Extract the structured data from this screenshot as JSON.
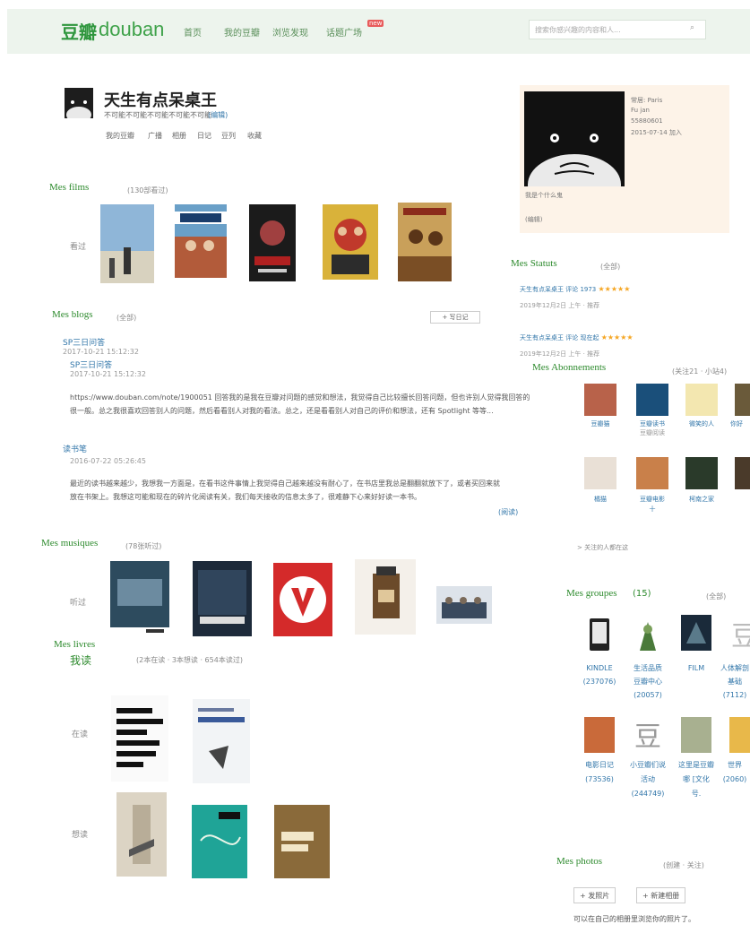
{
  "nav": {
    "logo_cn": "豆瓣",
    "logo_en": "douban",
    "links": [
      "首页",
      "我的豆瓣",
      "浏览发现",
      "话题广场"
    ],
    "new_badge": "new",
    "search_placeholder": "搜索你感兴趣的内容和人..."
  },
  "user": {
    "name": "天生有点呆桌王",
    "signature": "不可能不可能不可能不可能不可能",
    "signature_edit": "(编辑)",
    "tabs": [
      "我的豆瓣",
      "广播",
      "相册",
      "日记",
      "豆列",
      "收藏"
    ]
  },
  "films": {
    "title": "Mes films",
    "meta": "(130部看过)",
    "row_label": "看过"
  },
  "blogs": {
    "title": "Mes blogs",
    "meta": "(全部)",
    "write_button": "+ 写日记",
    "entries": [
      {
        "title": "SP三日问答",
        "date": "2017-10-21 15:12:32",
        "sub_title": "SP三日问答",
        "sub_date": "2017-10-21 15:12:32",
        "text": "https://www.douban.com/note/1900051 回答我的是我在豆瓣对问题的感觉和想法，我觉得自己比较擅长回答问题，但也许别人觉得我回答的很一般。总之我很喜欢回答别人的问题，然后看看别人对我的看法。总之，还是看看别人对自己的评价和想法，还有 Spotlight 等等..."
      },
      {
        "title": "读书笔",
        "date": "2016-07-22 05:26:45",
        "text": "最近的读书越来越少，我想我一方面是，在看书这件事情上我觉得自己越来越没有耐心了，在书店里我总是翻翻就放下了，或者买回来就放在书架上。我想这可能和现在的碎片化阅读有关，我们每天接收的信息太多了，很难静下心来好好读一本书。",
        "more": "(阅读)"
      }
    ]
  },
  "musiques": {
    "title": "Mes musiques",
    "meta": "(78张听过)",
    "row_label": "听过"
  },
  "livres": {
    "title": "Mes livres",
    "summary_label": "我读",
    "summary_meta": "(2本在读 · 3本想读 · 654本读过)",
    "row1_label": "在读",
    "row2_label": "想读"
  },
  "profile": {
    "lines": [
      "常居: Paris",
      "Fu jan",
      "55880601",
      "2015-07-14 加入"
    ],
    "intro": "我是个什么鬼",
    "edit": "(编辑)"
  },
  "statuts": {
    "title": "Mes Statuts",
    "meta": "(全部)",
    "items": [
      {
        "text": "天生有点呆桌王 评论 1973",
        "stars": "★★★★★",
        "date": "2019年12月2日 上午 · 推荐"
      },
      {
        "text": "天生有点呆桌王 评论 现在起",
        "stars": "★★★★★",
        "date": "2019年12月2日 上午 · 推荐"
      }
    ]
  },
  "abonnements": {
    "title": "Mes Abonnements",
    "meta": "(关注21 · 小站4)",
    "row1": [
      "豆瓣猫",
      "豆瓣读书",
      "微笑的人",
      "你好"
    ],
    "row1_sub": [
      "",
      "豆瓣阅读",
      "",
      ""
    ],
    "row2": [
      "橘猫",
      "豆瓣电影",
      "柯南之家",
      ""
    ],
    "row2_sub": [
      "",
      "十",
      "",
      ""
    ],
    "more": "> 关注的人都在这"
  },
  "groupes": {
    "title": "Mes groupes",
    "count": "(15)",
    "meta": "(全部)",
    "row1": [
      {
        "name": "KINDLE",
        "count": "(237076)"
      },
      {
        "name": "生活品质",
        "line2": "豆瓣中心",
        "count": "(20057)"
      },
      {
        "name": "FILM",
        "count": ""
      },
      {
        "name": "人体解剖",
        "line2": "基础",
        "count": "(7112)"
      }
    ],
    "row2": [
      {
        "name": "电影日记",
        "count": "(73536)"
      },
      {
        "name": "小豆瓣们说",
        "line2": "活动",
        "count": "(244749)"
      },
      {
        "name": "这里是豆瓣",
        "line2": "哪 [文化",
        "count": "号."
      },
      {
        "name": "世界",
        "count": "(2060)"
      }
    ]
  },
  "photos": {
    "title": "Mes photos",
    "meta": "(创建 · 关注)",
    "btn_upload": "+ 发照片",
    "btn_album": "+ 新建相册",
    "note": "可以在自己的相册里浏览你的照片了。"
  }
}
